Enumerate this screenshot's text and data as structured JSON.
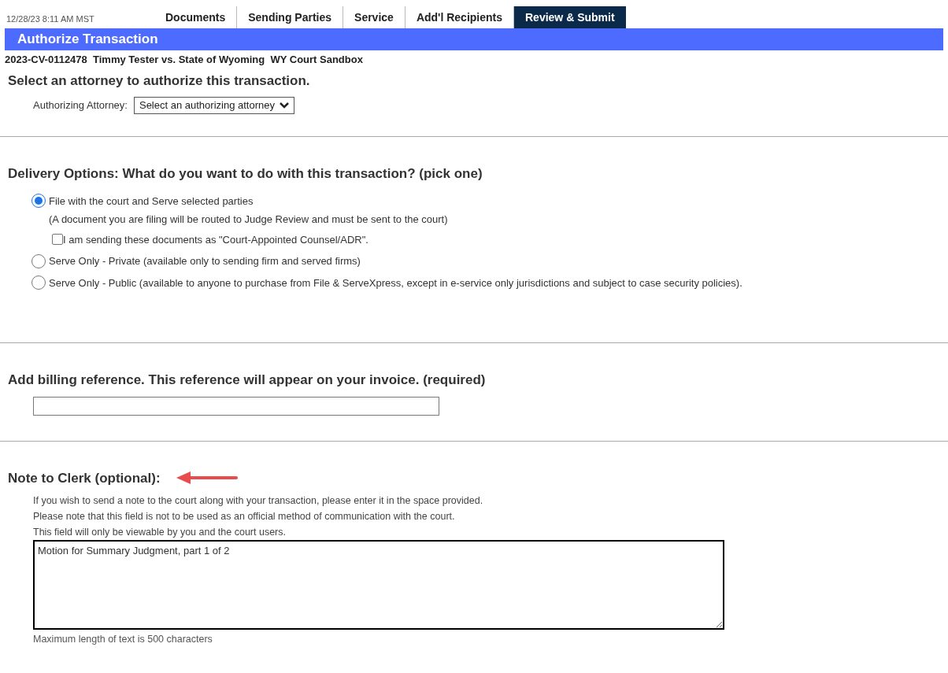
{
  "header": {
    "timestamp": "12/28/23 8:11 AM MST",
    "tabs": [
      {
        "label": "Documents",
        "selected": false
      },
      {
        "label": "Sending Parties",
        "selected": false
      },
      {
        "label": "Service",
        "selected": false
      },
      {
        "label": "Add'l Recipients",
        "selected": false
      },
      {
        "label": "Review & Submit",
        "selected": true
      }
    ]
  },
  "title_bar": "Authorize Transaction",
  "case_line": "2023-CV-0112478  Timmy Tester vs. State of Wyoming  WY Court Sandbox",
  "attorney_section": {
    "heading": "Select an attorney to authorize this transaction.",
    "label": "Authorizing Attorney:",
    "select_value": "Select an authorizing attorney"
  },
  "delivery_section": {
    "heading": "Delivery Options: What do you want to do with this transaction? (pick one)",
    "options": [
      {
        "label": "File with the court and Serve selected parties",
        "note": "(A document you are filing will be routed to Judge Review and must be sent to the court)",
        "checkbox": {
          "label": "I am sending these documents as \"Court-Appointed Counsel/ADR\".",
          "checked": false
        },
        "selected": true
      },
      {
        "label": "Serve Only - Private (available only to sending firm and served firms)",
        "selected": false
      },
      {
        "label": "Serve Only - Public (available to anyone to purchase from File & ServeXpress, except in e-service only jurisdictions and subject to case security policies).",
        "selected": false
      }
    ]
  },
  "billing_section": {
    "heading": "Add billing reference. This reference will appear on your invoice. (required)"
  },
  "note_section": {
    "heading": "Note to Clerk (optional):",
    "instructions": [
      "If you wish to send a note to the court along with your transaction, please enter it in the space provided.",
      "Please note that this field is not to be used as an official method of communication with the court.",
      "This field will only be viewable by you and the court users."
    ],
    "value": "Motion for Summary Judgment, part 1 of 2",
    "limit_note": "Maximum length of text is 500 characters"
  }
}
